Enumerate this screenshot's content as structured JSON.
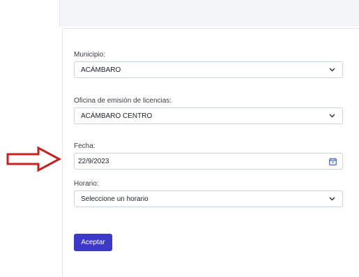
{
  "form": {
    "municipio": {
      "label": "Municipio:",
      "value": "ACÁMBARO"
    },
    "oficina": {
      "label": "Oficina de emisión de licencias:",
      "value": "ACÁMBARO CENTRO"
    },
    "fecha": {
      "label": "Fecha:",
      "value": "22/9/2023"
    },
    "horario": {
      "label": "Horario:",
      "value": "Seleccione un horario"
    },
    "submit_label": "Aceptar"
  },
  "icons": {
    "select": "chevron-down-icon",
    "date": "calendar-icon",
    "annotation": "red-outline-arrow-icon"
  },
  "colors": {
    "accent": "#3c38c9",
    "arrow": "#c8201f",
    "calendar": "#3c5bd6"
  }
}
